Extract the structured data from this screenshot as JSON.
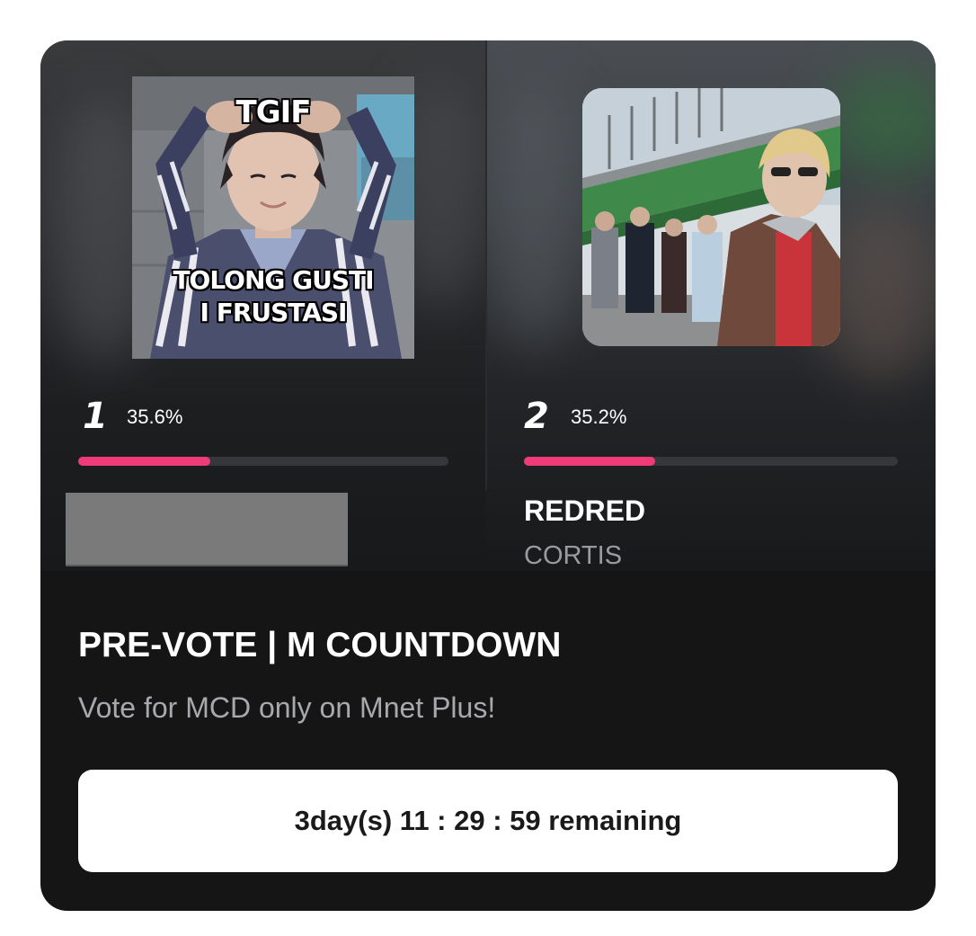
{
  "card": {
    "title": "PRE-VOTE | M COUNTDOWN",
    "subtitle": "Vote for MCD only on Mnet Plus!",
    "timer_text": "3day(s) 11 : 29 : 59 remaining"
  },
  "candidates": [
    {
      "rank": "1",
      "percent_label": "35.6%",
      "percent": 35.6,
      "image_caption_top": "TGIF",
      "image_caption_bottom_1": "TOLONG GUSTI",
      "image_caption_bottom_2": "I FRUSTASI"
    },
    {
      "rank": "2",
      "percent_label": "35.2%",
      "percent": 35.2,
      "song": "REDRED",
      "artist": "CORTIS"
    }
  ],
  "colors": {
    "accent": "#ef3b78",
    "card_background": "#151516",
    "track": "#36373a"
  }
}
